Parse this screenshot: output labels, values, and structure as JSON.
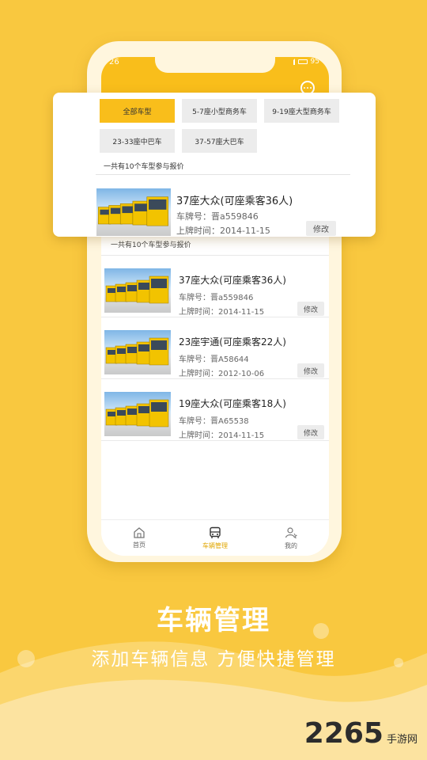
{
  "status": {
    "time": "26",
    "battery": "95"
  },
  "colors": {
    "accent": "#F9BE1B",
    "background": "#F9C83F",
    "text_primary": "#222222",
    "text_secondary": "#666666"
  },
  "filter_chips": [
    {
      "label": "全部车型",
      "active": true
    },
    {
      "label": "5-7座小型商务车",
      "active": false
    },
    {
      "label": "9-19座大型商务车",
      "active": false
    },
    {
      "label": "23-33座中巴车",
      "active": false
    },
    {
      "label": "37-57座大巴车",
      "active": false
    }
  ],
  "summary": "一共有10个车型参与报价",
  "popup_vehicle": {
    "name": "37座大众(可座乘客36人)",
    "plate": "车牌号：晋a559846",
    "date": "上牌时间：2014-11-15",
    "edit": "修改"
  },
  "vehicles": [
    {
      "name": "37座大众(可座乘客36人)",
      "plate": "车牌号：晋a559846",
      "date": "上牌时间：2014-11-15",
      "edit": "修改"
    },
    {
      "name": "23座宇通(可座乘客22人)",
      "plate": "车牌号：晋A58644",
      "date": "上牌时间：2012-10-06",
      "edit": "修改"
    },
    {
      "name": "19座大众(可座乘客18人)",
      "plate": "车牌号：晋A65538",
      "date": "上牌时间：2014-11-15",
      "edit": "修改"
    }
  ],
  "tabs": [
    {
      "label": "首页",
      "icon": "home-icon",
      "active": false
    },
    {
      "label": "车辆管理",
      "icon": "bus-icon",
      "active": true
    },
    {
      "label": "我的",
      "icon": "user-icon",
      "active": false
    }
  ],
  "promo": {
    "headline": "车辆管理",
    "subline": "添加车辆信息 方便快捷管理"
  },
  "watermark": {
    "number": "2265",
    "text": "手游网"
  }
}
